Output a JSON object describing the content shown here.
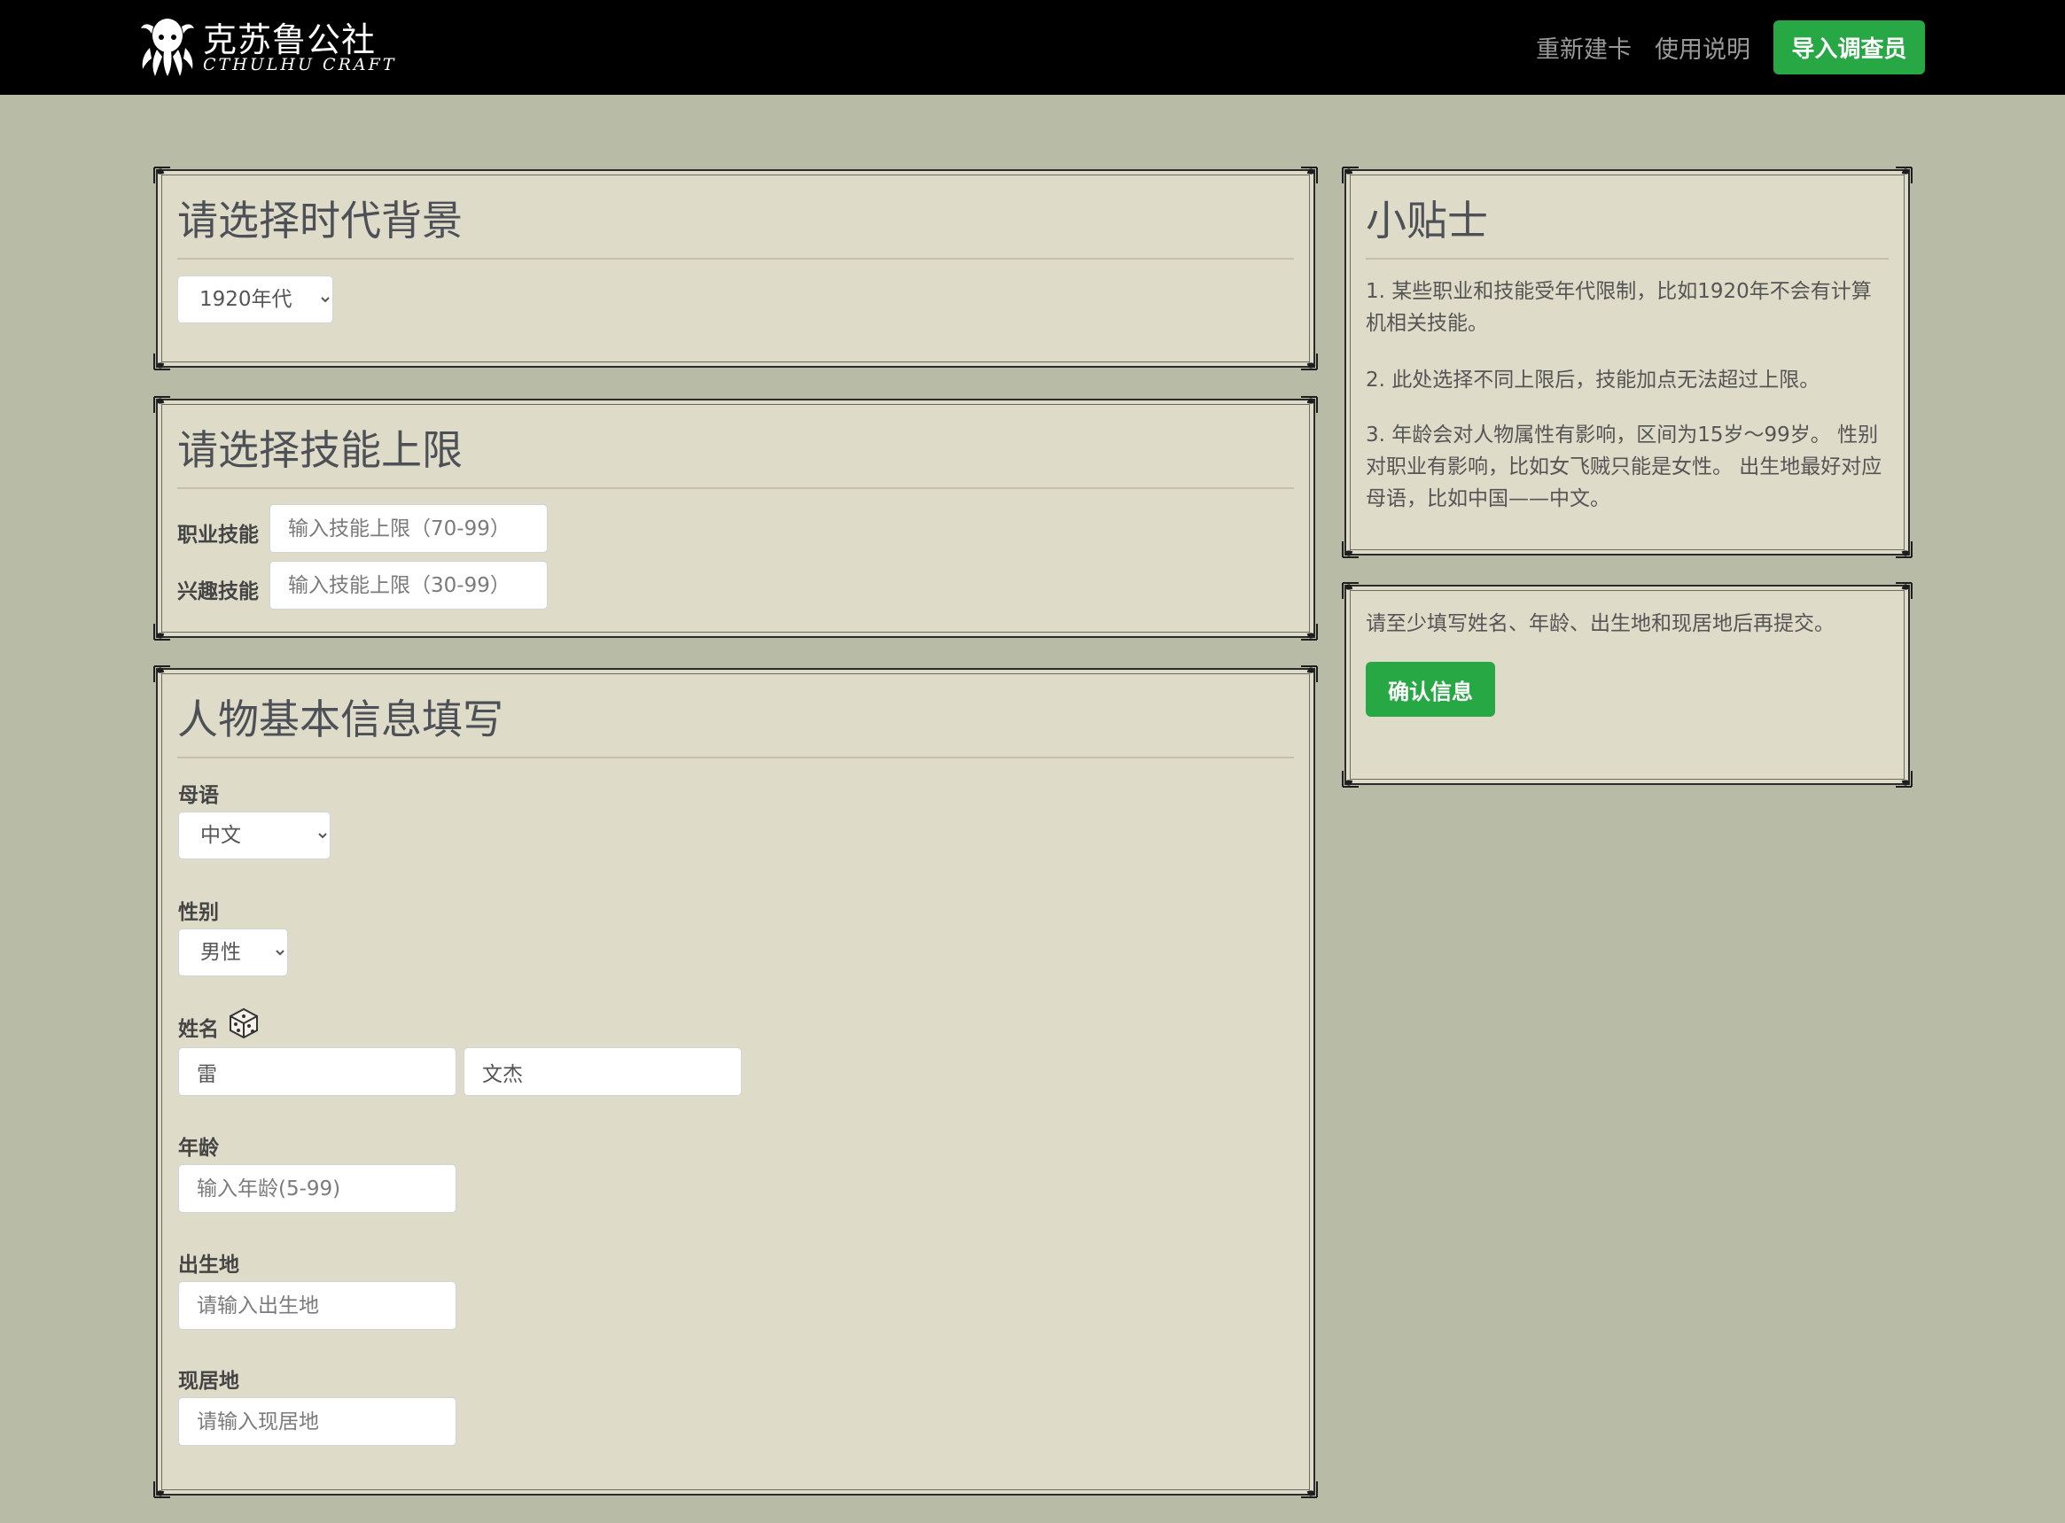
{
  "navbar": {
    "brand_cn": "克苏鲁公社",
    "brand_en": "CTHULHU CRAFT",
    "links": [
      "重新建卡",
      "使用说明"
    ],
    "import_button": "导入调查员"
  },
  "era_panel": {
    "title": "请选择时代背景",
    "selected": "1920年代"
  },
  "skill_panel": {
    "title": "请选择技能上限",
    "occupation_label": "职业技能",
    "occupation_placeholder": "输入技能上限（70-99）",
    "interest_label": "兴趣技能",
    "interest_placeholder": "输入技能上限（30-99）"
  },
  "info_panel": {
    "title": "人物基本信息填写",
    "language_label": "母语",
    "language_value": "中文",
    "gender_label": "性别",
    "gender_value": "男性",
    "name_label": "姓名",
    "surname_value": "雷",
    "given_name_value": "文杰",
    "age_label": "年龄",
    "age_placeholder": "输入年龄(5-99)",
    "birthplace_label": "出生地",
    "birthplace_placeholder": "请输入出生地",
    "residence_label": "现居地",
    "residence_placeholder": "请输入现居地"
  },
  "tips_panel": {
    "title": "小贴士",
    "tip1": "1. 某些职业和技能受年代限制，比如1920年不会有计算机相关技能。",
    "tip2": "2. 此处选择不同上限后，技能加点无法超过上限。",
    "tip3": "3. 年龄会对人物属性有影响，区间为15岁～99岁。 性别对职业有影响，比如女飞贼只能是女性。 出生地最好对应母语，比如中国——中文。"
  },
  "confirm_panel": {
    "notice": "请至少填写姓名、年龄、出生地和现居地后再提交。",
    "confirm_button": "确认信息"
  },
  "colors": {
    "page_bg": "#b8bba6",
    "panel_bg": "#dfdbc9",
    "accent_green": "#28a745",
    "navbar_bg": "#000000"
  }
}
